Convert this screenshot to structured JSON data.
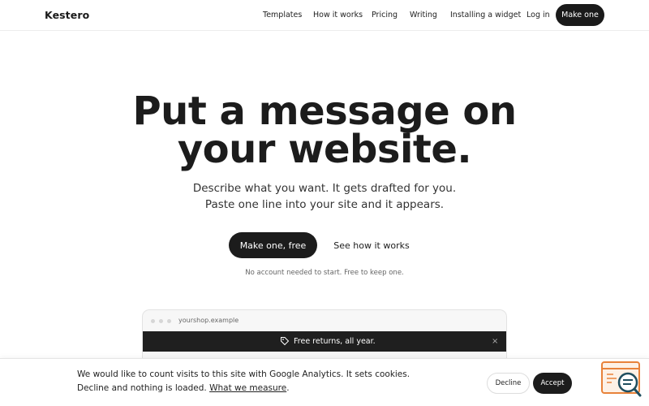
{
  "header": {
    "brand": "Kestero",
    "nav": [
      {
        "label": "Templates"
      },
      {
        "label": "How it works"
      },
      {
        "label": "Pricing"
      },
      {
        "label": "Writing"
      },
      {
        "label": "Installing a widget"
      },
      {
        "label": "Log in"
      }
    ],
    "cta_label": "Make one"
  },
  "hero": {
    "title_line1": "Put a message on",
    "title_line2": "your website.",
    "subtitle_line1": "Describe what you want. It gets drafted for you.",
    "subtitle_line2": "Paste one line into your site and it appears.",
    "primary_button": "Make one, free",
    "secondary_button": "See how it works",
    "note": "No account needed to start. Free to keep one."
  },
  "preview": {
    "url": "yourshop.example",
    "banner_icon": "tag-icon",
    "banner_text": "Free returns, all year.",
    "close_glyph": "×"
  },
  "cookie_bar": {
    "text_line1": "We would like to count visits to this site with Google Analytics. It sets cookies.",
    "text_line2_before": "Decline and nothing is loaded. ",
    "link_text": "What we measure",
    "text_line2_after": ".",
    "decline_label": "Decline",
    "accept_label": "Accept"
  },
  "widget": {
    "icon": "chat-search-icon",
    "accent_color": "#e8823a",
    "ring_color": "#1f4e5f"
  }
}
